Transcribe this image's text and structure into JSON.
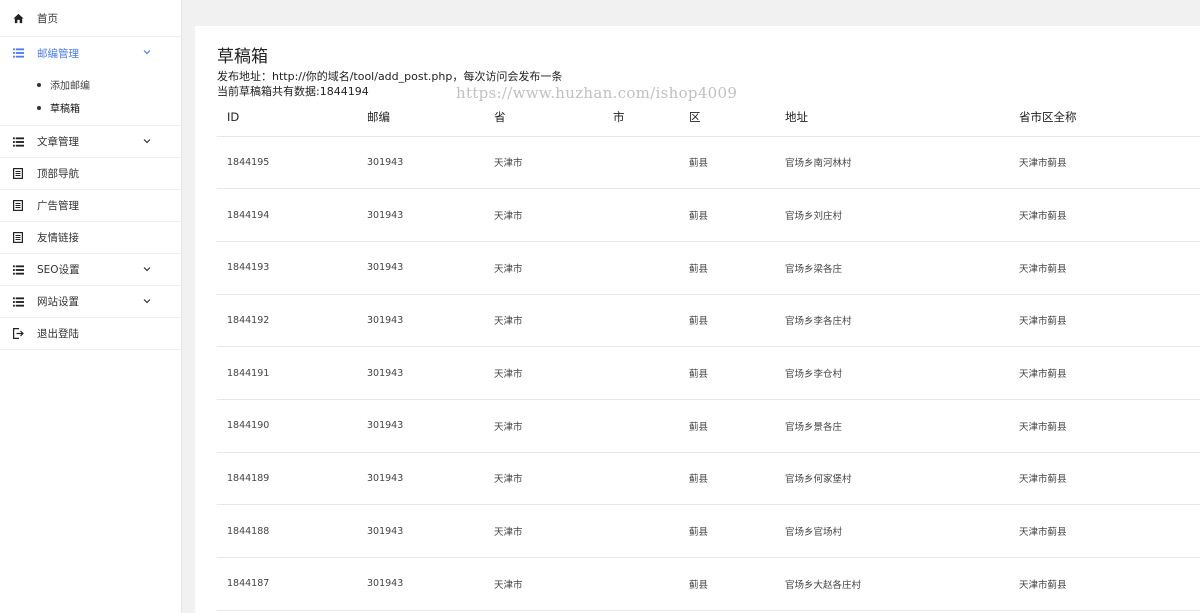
{
  "sidebar": {
    "home": "首页",
    "postal": {
      "label": "邮编管理",
      "sub": [
        "添加邮编",
        "草稿箱"
      ]
    },
    "articles": "文章管理",
    "topnav": "顶部导航",
    "ads": "广告管理",
    "links": "友情链接",
    "seo": "SEO设置",
    "site": "网站设置",
    "logout": "退出登陆"
  },
  "main": {
    "title": "草稿箱",
    "post_address": "发布地址：http://你的域名/tool/add_post.php，每次访问会发布一条",
    "count_text": "当前草稿箱共有数据:1844194",
    "watermark": "https://www.huzhan.com/ishop4009"
  },
  "table": {
    "headers": [
      "ID",
      "邮编",
      "省",
      "市",
      "区",
      "地址",
      "省市区全称"
    ],
    "rows": [
      [
        "1844195",
        "301943",
        "天津市",
        "",
        "蓟县",
        "官场乡南河林村",
        "天津市蓟县"
      ],
      [
        "1844194",
        "301943",
        "天津市",
        "",
        "蓟县",
        "官场乡刘庄村",
        "天津市蓟县"
      ],
      [
        "1844193",
        "301943",
        "天津市",
        "",
        "蓟县",
        "官场乡梁各庄",
        "天津市蓟县"
      ],
      [
        "1844192",
        "301943",
        "天津市",
        "",
        "蓟县",
        "官场乡李各庄村",
        "天津市蓟县"
      ],
      [
        "1844191",
        "301943",
        "天津市",
        "",
        "蓟县",
        "官场乡李仓村",
        "天津市蓟县"
      ],
      [
        "1844190",
        "301943",
        "天津市",
        "",
        "蓟县",
        "官场乡景各庄",
        "天津市蓟县"
      ],
      [
        "1844189",
        "301943",
        "天津市",
        "",
        "蓟县",
        "官场乡何家堡村",
        "天津市蓟县"
      ],
      [
        "1844188",
        "301943",
        "天津市",
        "",
        "蓟县",
        "官场乡官场村",
        "天津市蓟县"
      ],
      [
        "1844187",
        "301943",
        "天津市",
        "",
        "蓟县",
        "官场乡大赵各庄村",
        "天津市蓟县"
      ]
    ]
  },
  "colors": {
    "accent": "#4a7cf7",
    "background": "#f1f1f1",
    "panel": "#ffffff"
  },
  "icons": {
    "home": "home-icon",
    "list": "list-icon",
    "document": "document-icon",
    "logout": "logout-icon",
    "chevron": "chevron-down-icon"
  }
}
